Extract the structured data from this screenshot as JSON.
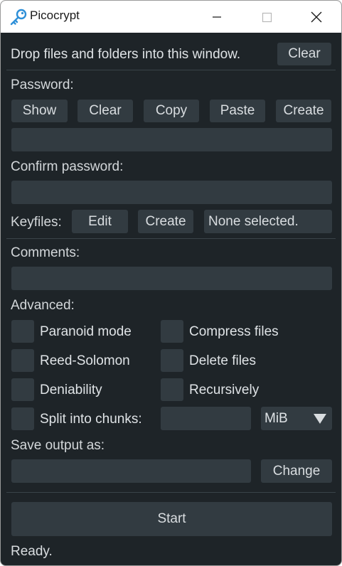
{
  "window": {
    "title": "Picocrypt"
  },
  "drop": {
    "message": "Drop files and folders into this window.",
    "clear_label": "Clear"
  },
  "password": {
    "label": "Password:",
    "buttons": [
      "Show",
      "Clear",
      "Copy",
      "Paste",
      "Create"
    ],
    "value": ""
  },
  "confirm": {
    "label": "Confirm password:",
    "value": ""
  },
  "keyfiles": {
    "label": "Keyfiles:",
    "edit_label": "Edit",
    "create_label": "Create",
    "status": "None selected."
  },
  "comments": {
    "label": "Comments:",
    "value": ""
  },
  "advanced": {
    "label": "Advanced:",
    "options": {
      "paranoid": "Paranoid mode",
      "compress": "Compress files",
      "reed_solomon": "Reed-Solomon",
      "delete_files": "Delete files",
      "deniability": "Deniability",
      "recursively": "Recursively",
      "split": "Split into chunks:"
    },
    "chunk_size": "",
    "chunk_unit": "MiB"
  },
  "output": {
    "label": "Save output as:",
    "value": "",
    "change_label": "Change"
  },
  "start_label": "Start",
  "status": "Ready."
}
